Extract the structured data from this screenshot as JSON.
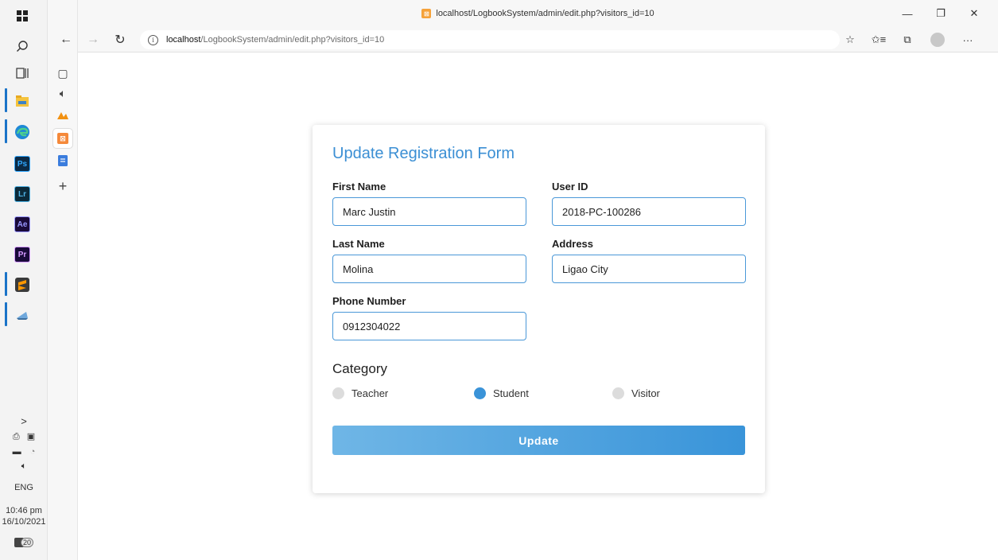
{
  "window": {
    "title": "localhost/LogbookSystem/admin/edit.php?visitors_id=10",
    "minimize": "—",
    "restore": "❐",
    "close": "✕"
  },
  "navigation": {
    "back": "←",
    "forward": "→",
    "refresh": "↻",
    "info": "i",
    "url_host": "localhost",
    "url_path": "/LogbookSystem/admin/edit.php?visitors_id=10",
    "more": "···"
  },
  "tab_strip": {
    "new_tab": "+"
  },
  "taskbar": {
    "apps": [
      {
        "name": "Photoshop",
        "label": "Ps",
        "bg": "#0b2a45",
        "fg": "#31a8ff"
      },
      {
        "name": "Lightroom",
        "label": "Lr",
        "bg": "#0b2a3a",
        "fg": "#4fb3e6"
      },
      {
        "name": "After Effects",
        "label": "Ae",
        "bg": "#1a0b3a",
        "fg": "#9999ff"
      },
      {
        "name": "Premiere",
        "label": "Pr",
        "bg": "#1a0b3a",
        "fg": "#9999ff"
      }
    ],
    "tray": {
      "chevron": ">",
      "language": "ENG",
      "time": "10:46 pm",
      "date": "16/10/2021",
      "notification_count": "20"
    }
  },
  "form": {
    "title": "Update Registration Form",
    "first_name": {
      "label": "First Name",
      "value": "Marc Justin"
    },
    "user_id": {
      "label": "User ID",
      "value": "2018-PC-100286"
    },
    "last_name": {
      "label": "Last Name",
      "value": "Molina"
    },
    "address": {
      "label": "Address",
      "value": "Ligao City"
    },
    "phone": {
      "label": "Phone Number",
      "value": "0912304022"
    },
    "category": {
      "title": "Category",
      "options": [
        {
          "label": "Teacher",
          "selected": false
        },
        {
          "label": "Student",
          "selected": true
        },
        {
          "label": "Visitor",
          "selected": false
        }
      ]
    },
    "submit_label": "Update"
  },
  "colors": {
    "accent": "#3b8fd4",
    "input_border": "#4a98d8",
    "radio_selected": "#3a93d8"
  }
}
